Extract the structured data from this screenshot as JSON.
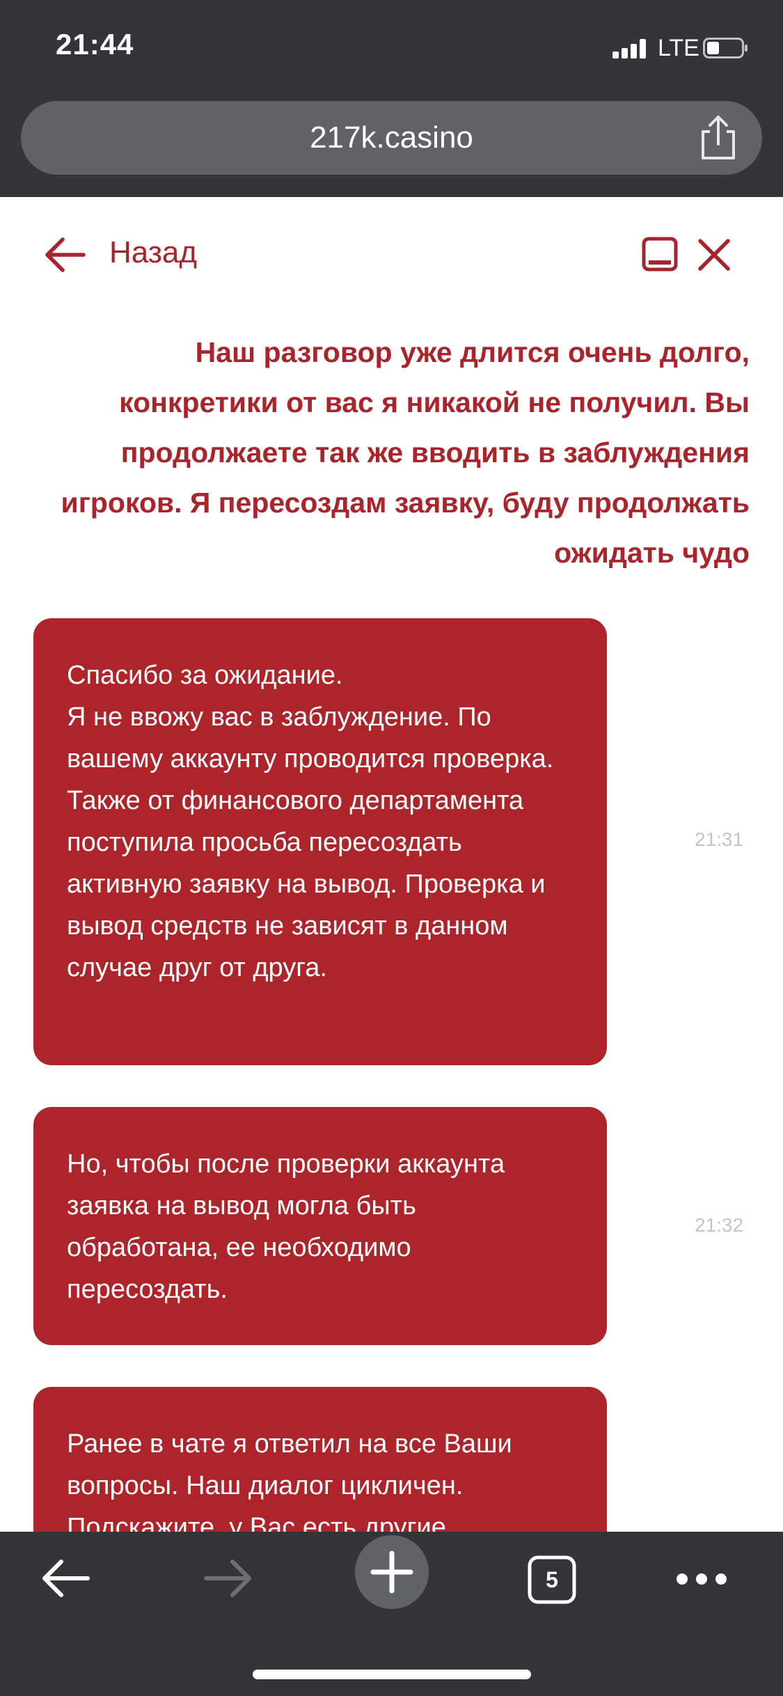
{
  "status_bar": {
    "time": "21:44",
    "network": "LTE"
  },
  "browser": {
    "url": "217k.casino",
    "tabs_count": "5"
  },
  "chat": {
    "back_label": "Назад",
    "user_message": "Наш разговор уже длится очень долго, конкретики от вас я никакой не получил. Вы продолжаете так же вводить в заблуждения игроков. Я пересоздам заявку, буду продолжать ожидать чудо",
    "messages": [
      {
        "text": "Спасибо за ожидание.\nЯ не ввожу вас в заблуждение. По вашему аккаунту проводится проверка. Также от финансового департамента поступила просьба пересоздать активную заявку на вывод. Проверка и вывод средств не зависят в данном случае друг от друга.",
        "time": "21:31"
      },
      {
        "text": "Но, чтобы после проверки аккаунта заявка на вывод могла быть обработана, ее необходимо пересоздать.",
        "time": "21:32"
      },
      {
        "text": "Ранее в чате я ответил на все Ваши вопросы. Наш диалог цикличен. Подскажите, у Вас есть другие",
        "time": ""
      }
    ]
  },
  "colors": {
    "accent": "#ab232b",
    "bubble": "#ad242b",
    "chrome": "#333538",
    "url_bar": "#5f6266",
    "timestamp": "#c4c4c4"
  },
  "icons": {
    "share": "share-icon",
    "back": "arrow-left-icon",
    "minimize": "minimize-icon",
    "close": "close-icon",
    "nav_back": "nav-back-icon",
    "nav_forward": "nav-forward-icon",
    "new_tab": "plus-icon",
    "tabs": "tabs-icon",
    "more": "more-icon"
  }
}
